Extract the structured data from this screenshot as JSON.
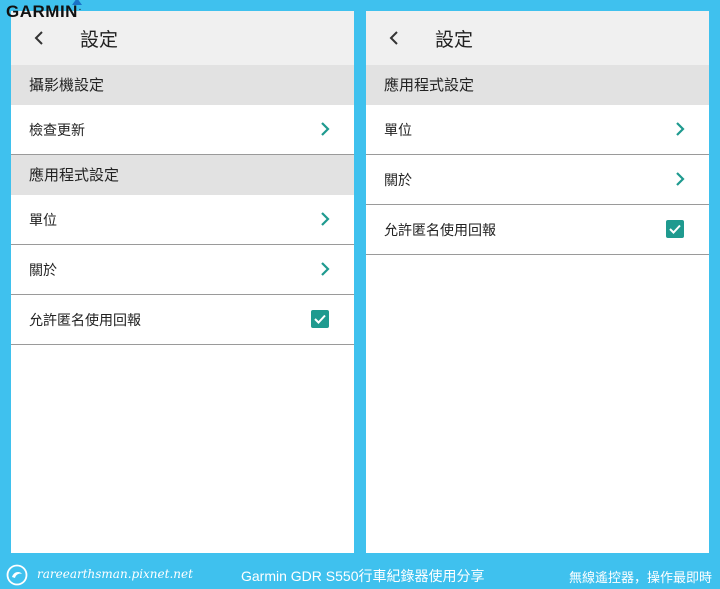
{
  "logo": {
    "text": "GARMIN",
    "mark": "."
  },
  "left_panel": {
    "title": "設定",
    "sections": [
      {
        "header": "攝影機設定",
        "items": [
          {
            "label": "檢查更新",
            "control": "chevron"
          }
        ]
      },
      {
        "header": "應用程式設定",
        "items": [
          {
            "label": "單位",
            "control": "chevron"
          },
          {
            "label": "關於",
            "control": "chevron"
          },
          {
            "label": "允許匿名使用回報",
            "control": "checkbox",
            "checked": true
          }
        ]
      }
    ]
  },
  "right_panel": {
    "title": "設定",
    "sections": [
      {
        "header": "應用程式設定",
        "items": [
          {
            "label": "單位",
            "control": "chevron"
          },
          {
            "label": "關於",
            "control": "chevron"
          },
          {
            "label": "允許匿名使用回報",
            "control": "checkbox",
            "checked": true
          }
        ]
      }
    ]
  },
  "footer": {
    "site": "rareearthsman.pixnet.net",
    "title": "Garmin GDR S550行車紀錄器使用分享",
    "tagline": "無線遙控器，操作最即時"
  },
  "colors": {
    "accent": "#1f9a8f",
    "background": "#3fc1ee"
  }
}
